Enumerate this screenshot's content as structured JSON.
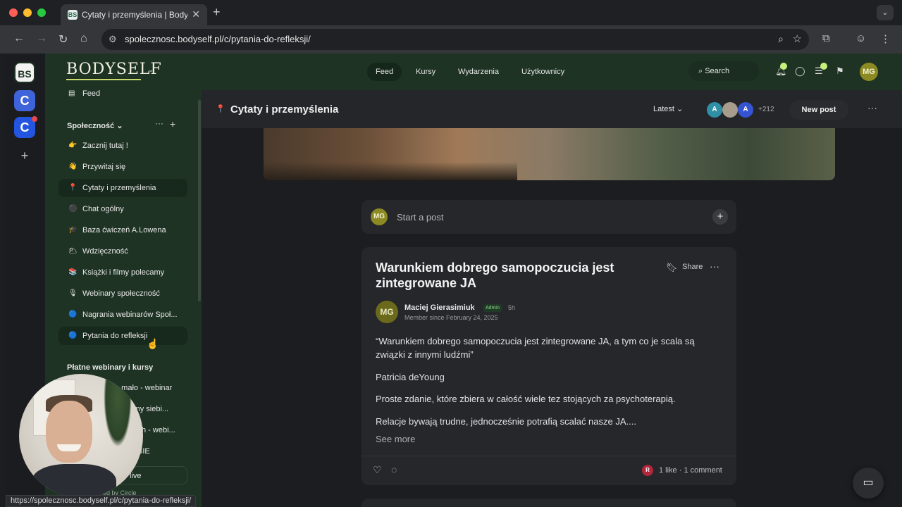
{
  "browser": {
    "tab_title": "Cytaty i przemyślenia | Bodyself",
    "tab_favicon": "BS",
    "url": "spolecznosc.bodyself.pl/c/pytania-do-refleksji/",
    "status_url": "https://spolecznosc.bodyself.pl/c/pytania-do-refleksji/"
  },
  "rail": {
    "items": [
      "BS",
      "C",
      "C"
    ],
    "add": "+"
  },
  "header": {
    "logo": "BODYSELF",
    "nav": [
      "Feed",
      "Kursy",
      "Wydarzenia",
      "Użytkownicy"
    ],
    "search": "Search",
    "user_initials": "MG"
  },
  "sidebar": {
    "feed_label": "Feed",
    "section1": "Społeczność",
    "items": [
      {
        "emoji": "👉",
        "label": "Zacznij tutaj !"
      },
      {
        "emoji": "👋",
        "label": "Przywitaj się"
      },
      {
        "emoji": "📍",
        "label": "Cytaty i przemyślenia"
      },
      {
        "emoji": "⚫",
        "label": "Chat ogólny"
      },
      {
        "emoji": "🎓",
        "label": "Baza ćwiczeń A.Lowena"
      },
      {
        "emoji": "🌥",
        "label": "Wdzięczność"
      },
      {
        "emoji": "📚",
        "label": "Książki i filmy polecamy"
      },
      {
        "emoji": "🎙",
        "label": "Webinary społeczność"
      },
      {
        "emoji": "🔵",
        "label": "Nagrania webinarów Społ..."
      },
      {
        "emoji": "🔵",
        "label": "Pytania do refleksji"
      }
    ],
    "section2": "Płatne webinary i kursy",
    "paid_items": [
      "a mało - webinar",
      "iemy siebi...",
      "h - webi...",
      "BIE"
    ],
    "live_label": "live",
    "powered": "ed by Circle"
  },
  "channel": {
    "title": "Cytaty i przemyślenia",
    "sort": "Latest",
    "member_avatars": [
      "A",
      "",
      "A"
    ],
    "member_more": "+212",
    "new_post": "New post"
  },
  "composer": {
    "avatar": "MG",
    "placeholder": "Start a post"
  },
  "post": {
    "title": "Warunkiem dobrego samopoczucia jest zintegrowane JA",
    "share": "Share",
    "author": "Maciej Gierasimiuk",
    "author_initials": "MG",
    "badge": "Admin",
    "time": "5h",
    "member_since": "Member since February 24, 2025",
    "paragraphs": [
      "“Warunkiem dobrego samopoczucia jest zintegrowane JA, a tym co je scala są związki z innymi ludźmi”",
      "Patricia deYoung",
      "Proste zdanie, które zbiera w całość wiele tez stojących za psychoterapią.",
      "Relacje bywają trudne, jednocześnie potrafią scalać nasze JA...."
    ],
    "see_more": "See more",
    "liker_initial": "R",
    "stats": "1 like · 1 comment"
  },
  "colors": {
    "accent": "#1e3324",
    "badge": "#8fd68f"
  }
}
